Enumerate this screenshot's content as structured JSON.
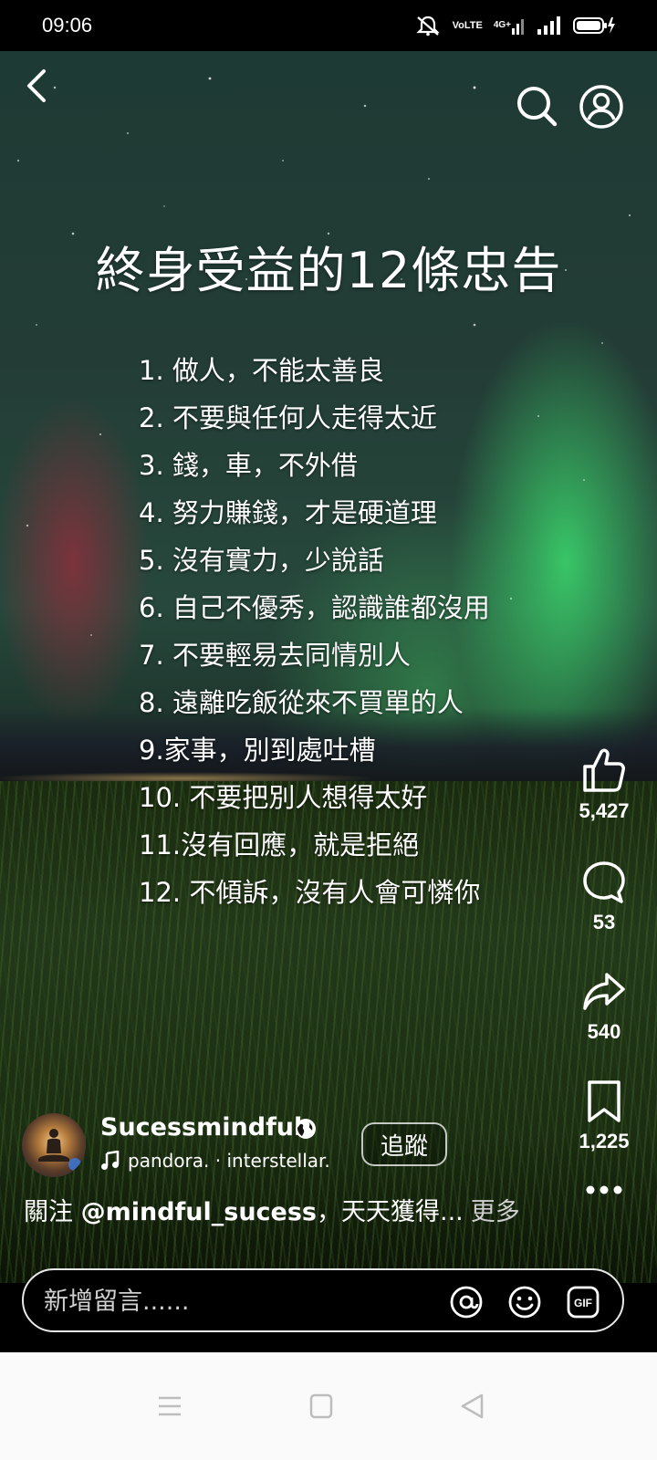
{
  "status_bar": {
    "time": "09:06",
    "volte_label": "VoLTE",
    "network_label": "4G+"
  },
  "post": {
    "title": "終身受益的12條忠告",
    "advice": [
      "1. 做人，不能太善良",
      "2. 不要與任何人走得太近",
      "3. 錢，車，不外借",
      "4. 努力賺錢，才是硬道理",
      "5. 沒有實力，少說話",
      "6. 自己不優秀，認識誰都沒用",
      "7. 不要輕易去同情別人",
      "8. 遠離吃飯從來不買單的人",
      "9.家事，別到處吐槽",
      "10. 不要把別人想得太好",
      "11.沒有回應，就是拒絕",
      "12. 不傾訴，沒有人會可憐你"
    ]
  },
  "actions": {
    "likes": "5,427",
    "comments": "53",
    "shares": "540",
    "saves": "1,225"
  },
  "author": {
    "name": "Sucessmindful",
    "music": "pandora. · interstellar.",
    "follow_label": "追蹤"
  },
  "caption": {
    "prefix": "關注 ",
    "mention": "@mindful_sucess",
    "rest": "，天天獲得...",
    "more": "更多"
  },
  "comment_bar": {
    "placeholder": "新增留言......"
  },
  "icons": {
    "back": "chevron-left-icon",
    "search": "search-icon",
    "profile": "profile-icon",
    "like": "thumbs-up-icon",
    "comment": "comment-bubble-icon",
    "share": "share-arrow-icon",
    "save": "bookmark-icon",
    "more": "more-dots-icon",
    "mention": "at-sign-icon",
    "emoji": "emoji-icon",
    "gif": "gif-icon"
  }
}
